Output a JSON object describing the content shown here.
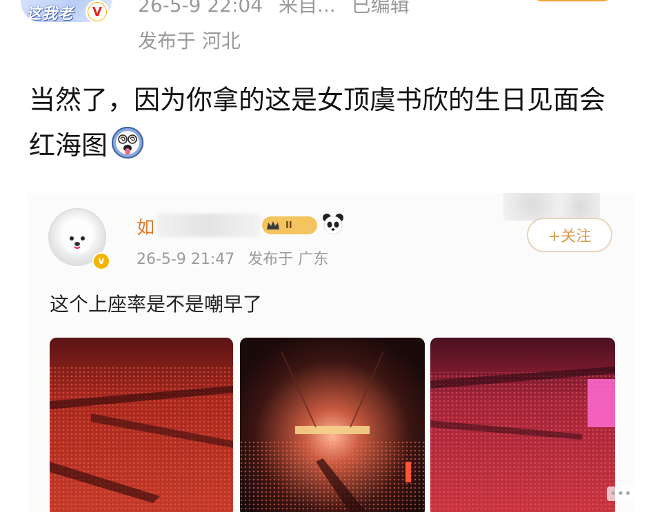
{
  "header": {
    "avatar_text": "这我老",
    "verified_mark": "V",
    "date": "26-5-9 22:04",
    "source": "来自...",
    "edited": "已编辑",
    "location": "发布于 河北"
  },
  "post": {
    "text": "当然了，因为你拿的这是女顶虞书欣的生日见面会红海图",
    "emoji_icon": "dizzy-face-emoji"
  },
  "embedded_post": {
    "username_visible": "如",
    "level_badge": "II",
    "date": "26-5-9 21:47",
    "location": "发布于 广东",
    "follow_label": "+关注",
    "text": "这个上座率是不是嘲早了",
    "photos": [
      {
        "name": "arena-photo-1",
        "tint": "#c0392b"
      },
      {
        "name": "arena-photo-2",
        "tint": "#e05a3a"
      },
      {
        "name": "arena-photo-3",
        "tint": "#d63a55"
      }
    ]
  },
  "colors": {
    "accent_orange": "#f5b400",
    "meta_gray": "#9a9a9a",
    "follow_gold": "#d49a4a"
  }
}
